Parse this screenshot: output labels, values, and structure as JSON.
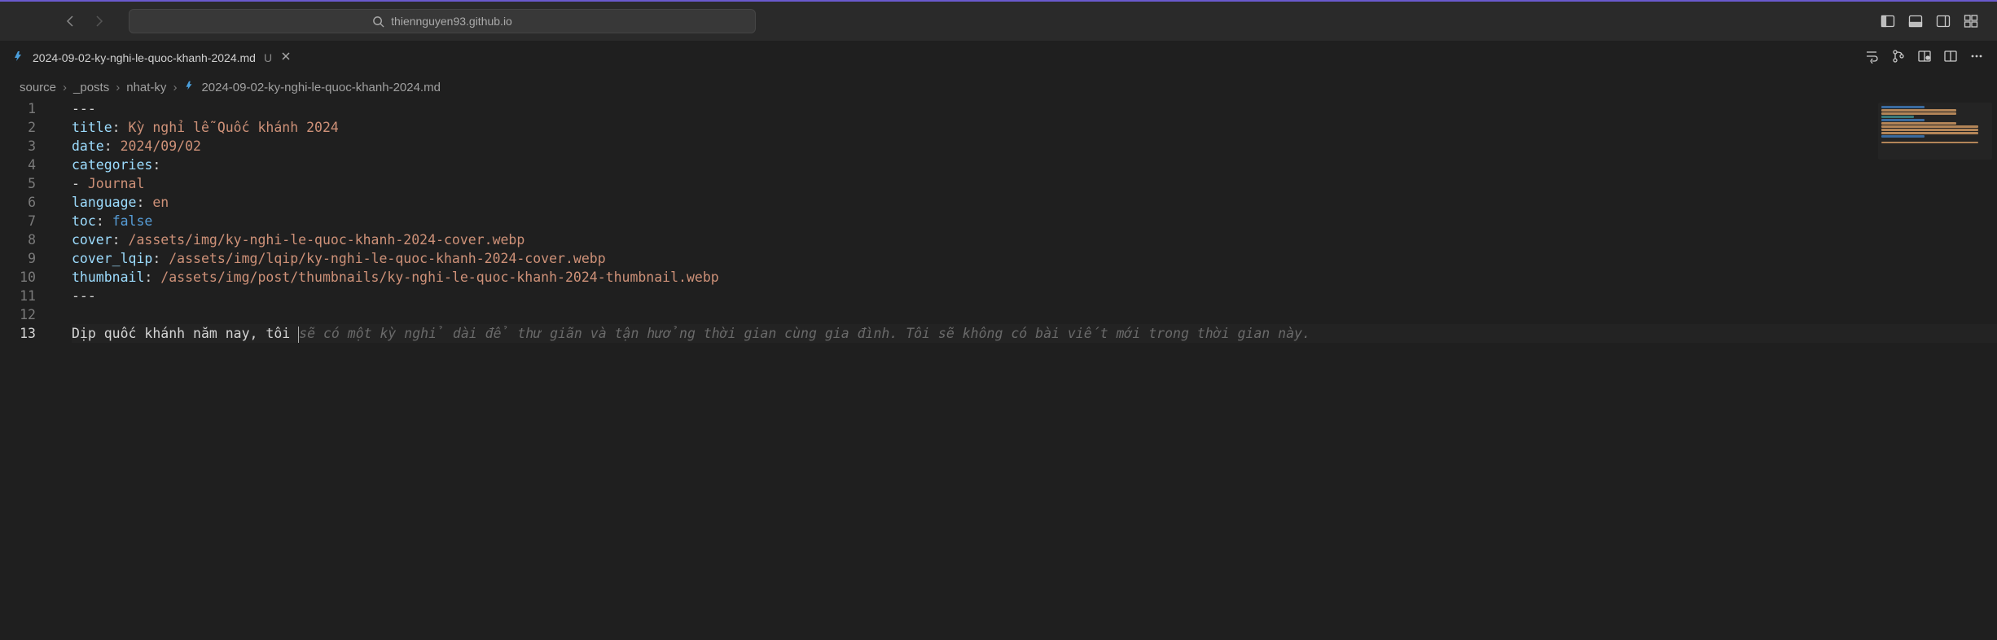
{
  "titlebar": {
    "url": "thiennguyen93.github.io"
  },
  "tab": {
    "filename": "2024-09-02-ky-nghi-le-quoc-khanh-2024.md",
    "status": "U"
  },
  "breadcrumbs": {
    "parts": [
      "source",
      "_posts",
      "nhat-ky",
      "2024-09-02-ky-nghi-le-quoc-khanh-2024.md"
    ]
  },
  "editor": {
    "lines": {
      "l1": "---",
      "l2_key": "title",
      "l2_val": "Kỳ nghỉ lễ Quốc khánh 2024",
      "l3_key": "date",
      "l3_val": "2024/09/02",
      "l4_key": "categories",
      "l5_val": "Journal",
      "l6_key": "language",
      "l6_val": "en",
      "l7_key": "toc",
      "l7_val": "false",
      "l8_key": "cover",
      "l8_val": "/assets/img/ky-nghi-le-quoc-khanh-2024-cover.webp",
      "l9_key": "cover_lqip",
      "l9_val": "/assets/img/lqip/ky-nghi-le-quoc-khanh-2024-cover.webp",
      "l10_key": "thumbnail",
      "l10_val": "/assets/img/post/thumbnails/ky-nghi-le-quoc-khanh-2024-thumbnail.webp",
      "l11": "---",
      "l13_typed": "Dịp quốc khánh năm nay, tôi ",
      "l13_ghost": "sẽ có một kỳ nghỉ dài để thư giãn và tận hưởng thời gian cùng gia đình. Tôi sẽ không có bài viết mới trong thời gian này."
    },
    "line_numbers": [
      "1",
      "2",
      "3",
      "4",
      "5",
      "6",
      "7",
      "8",
      "9",
      "10",
      "11",
      "12",
      "13"
    ]
  }
}
